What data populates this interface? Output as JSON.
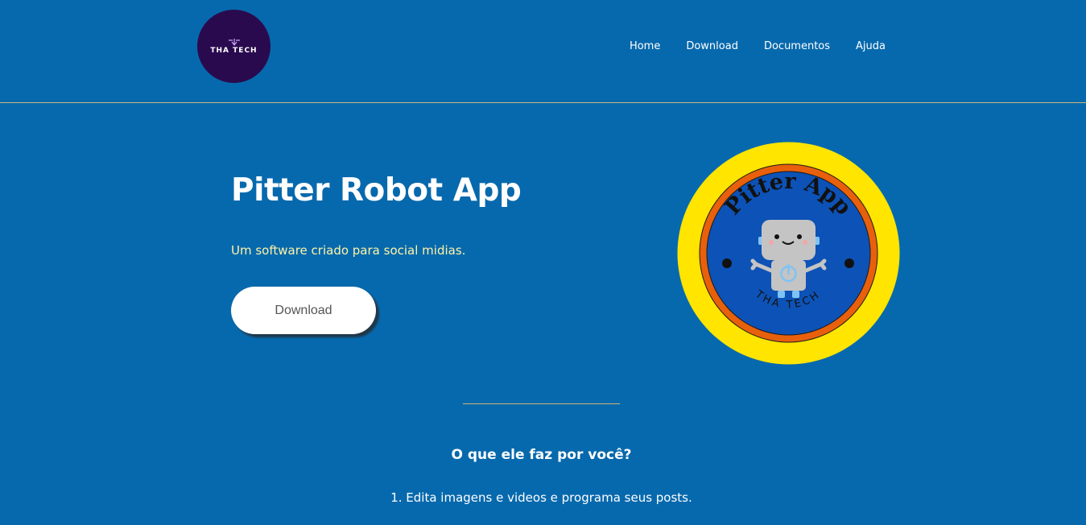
{
  "header": {
    "logo_text": "THA TECH",
    "nav": [
      "Home",
      "Download",
      "Documentos",
      "Ajuda"
    ]
  },
  "hero": {
    "title": "Pitter Robot App",
    "subtitle": "Um software criado para social midias.",
    "download_button": "Download",
    "badge": {
      "top_text": "Pitter App",
      "bottom_text": "THA TECH"
    }
  },
  "features": {
    "heading": "O que ele faz por você?",
    "items": [
      "1. Edita imagens e videos e programa seus posts."
    ]
  },
  "colors": {
    "background": "#0769ad",
    "subtitle": "#fff3a6",
    "badge_outer": "#ffe500",
    "badge_ring": "#e8600c",
    "badge_inner": "#0d52b6",
    "logo_bg": "#2a0a4e"
  }
}
